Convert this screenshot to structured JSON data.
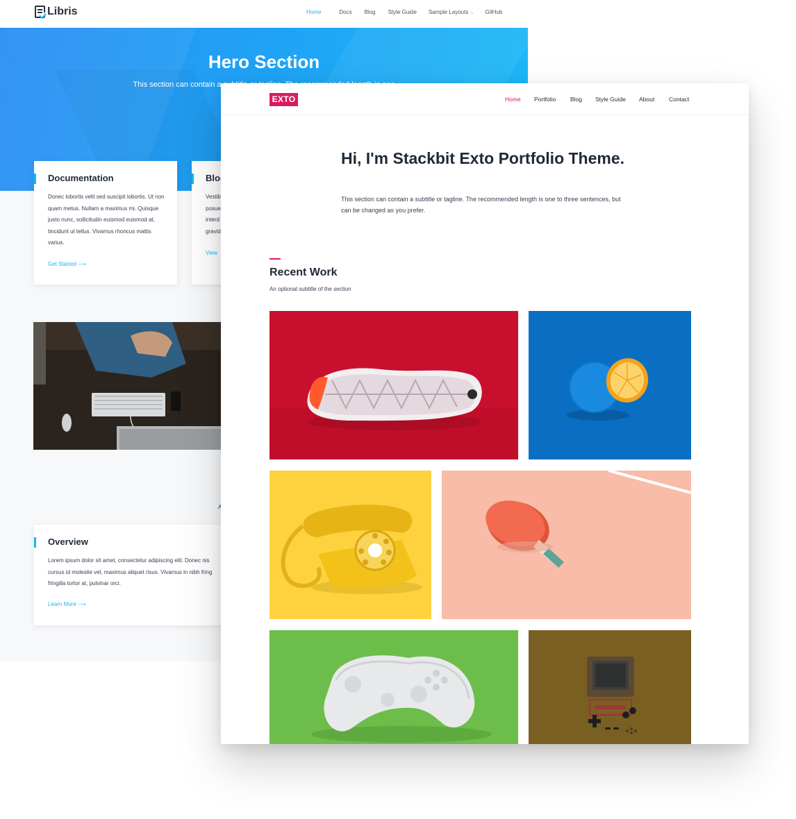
{
  "libris": {
    "logo": "Libris",
    "nav": [
      {
        "label": "Home",
        "active": true
      },
      {
        "label": "Docs"
      },
      {
        "label": "Blog"
      },
      {
        "label": "Style Guide"
      },
      {
        "label": "Sample Layouts"
      },
      {
        "label": "GitHub"
      }
    ],
    "hero": {
      "title": "Hero Section",
      "subtitle": "This section can contain a subtitle or tagline. The recommended length is one to three sentences"
    },
    "cards": [
      {
        "title": "Documentation",
        "body": "Donec lobortis velit sed suscipit lobortis. Ut non quam metus. Nullam a maximus mi. Quisque justo nunc, sollicitudin euismod euismod at, tincidunt ut tellus. Vivamus rhoncus mattis varius.",
        "link": "Get Started"
      },
      {
        "title": "Blog",
        "body": "Vestib posue interd gravid",
        "link": "View"
      }
    ],
    "fragment": "A",
    "overview": {
      "title": "Overview",
      "body": "Lorem ipsum dolor sit amet, consectetur adipiscing elit. Donec nis cursus id molestie vel, maximus aliquet risus. Vivamus in nibh fring fringilla tortor at, pulvinar orci.",
      "link": "Learn More"
    },
    "colors": {
      "accent": "#19b4f1",
      "hero_start": "#2a8ff3",
      "hero_end": "#1cb9f7"
    }
  },
  "exto": {
    "brand": "EXTO",
    "nav": [
      {
        "label": "Home",
        "active": true
      },
      {
        "label": "Portfolio"
      },
      {
        "label": "Blog"
      },
      {
        "label": "Style Guide"
      },
      {
        "label": "About"
      },
      {
        "label": "Contact"
      }
    ],
    "intro": {
      "title": "Hi, I'm Stackbit Exto Portfolio Theme.",
      "subtitle": "This section can contain a subtitle or tagline. The recommended length is one to three sentences, but can be changed as you prefer."
    },
    "section": {
      "title": "Recent Work",
      "subtitle": "An optional subtitle of the section"
    },
    "portfolio": [
      {
        "image": "sneaker-sole-on-red",
        "color": "#c8102e"
      },
      {
        "image": "blue-orange-on-blue",
        "color": "#0a6fc2"
      },
      {
        "image": "yellow-rotary-phone",
        "color": "#fdd23e"
      },
      {
        "image": "ping-pong-paddle-on-pink",
        "color": "#f8bca8"
      },
      {
        "image": "white-game-controller-on-green",
        "color": "#6cbd4a"
      },
      {
        "image": "handheld-console-on-olive",
        "color": "#7a5f22"
      }
    ],
    "colors": {
      "accent": "#d81b60"
    }
  }
}
